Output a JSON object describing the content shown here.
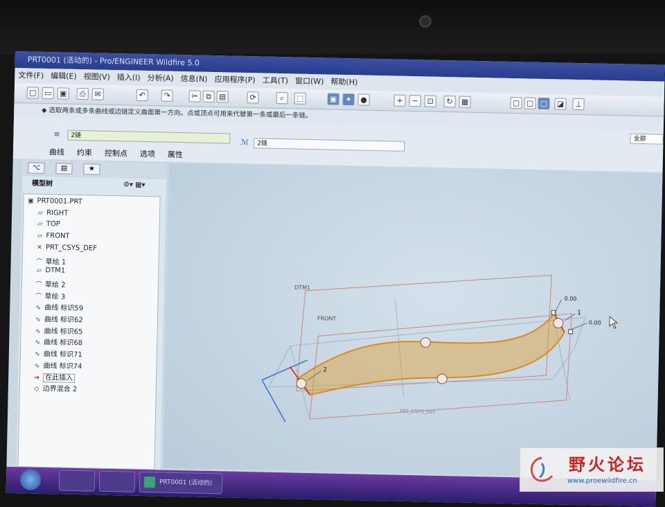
{
  "window": {
    "title": "PRT0001 (活动的) - Pro/ENGINEER Wildfire 5.0"
  },
  "menu": {
    "items": [
      "文件(F)",
      "编辑(E)",
      "视图(V)",
      "插入(I)",
      "分析(A)",
      "信息(N)",
      "应用程序(P)",
      "工具(T)",
      "窗口(W)",
      "帮助(H)"
    ]
  },
  "toolbar": {
    "icons": [
      "new-icon",
      "open-icon",
      "save-icon",
      "print-icon",
      "email-icon",
      "undo-icon",
      "redo-icon",
      "cut-icon",
      "copy-icon",
      "paste-icon",
      "regenerate-icon",
      "find-icon",
      "select-box-icon",
      "datum-display-icon",
      "spin-center-icon",
      "shading-icon",
      "zoom-in-icon",
      "zoom-out-icon",
      "refit-icon",
      "orient-icon",
      "view-manager-icon",
      "wireframe-icon",
      "hidden-line-icon",
      "shade-icon",
      "datum-plane-icon",
      "datum-axis-icon"
    ]
  },
  "prompt": {
    "text": "◆ 选取两条或多条曲线或边链定义曲面第一方向。点或顶点可用来代替第一条或最后一条链。"
  },
  "dashboard": {
    "first_direction_value": "2链",
    "second_direction_value": "2链",
    "tabs": [
      "曲线",
      "约束",
      "控制点",
      "选项",
      "属性"
    ],
    "filter_value": "全部"
  },
  "model_tree": {
    "header": "模型树",
    "items": [
      {
        "icon": "part-icon",
        "label": "PRT0001.PRT"
      },
      {
        "icon": "datum-plane-icon",
        "label": "RIGHT"
      },
      {
        "icon": "datum-plane-icon",
        "label": "TOP"
      },
      {
        "icon": "datum-plane-icon",
        "label": "FRONT"
      },
      {
        "icon": "csys-icon",
        "label": "PRT_CSYS_DEF"
      },
      {
        "icon": "sketch-icon",
        "label": "草绘 1"
      },
      {
        "icon": "datum-plane-icon",
        "label": "DTM1"
      },
      {
        "icon": "sketch-icon",
        "label": "草绘 2"
      },
      {
        "icon": "sketch-icon",
        "label": "草绘 3"
      },
      {
        "icon": "curve-icon",
        "label": "曲线 标识59"
      },
      {
        "icon": "curve-icon",
        "label": "曲线 标识62"
      },
      {
        "icon": "curve-icon",
        "label": "曲线 标识65"
      },
      {
        "icon": "curve-icon",
        "label": "曲线 标识68"
      },
      {
        "icon": "curve-icon",
        "label": "曲线 标识71"
      },
      {
        "icon": "curve-icon",
        "label": "曲线 标识74"
      },
      {
        "icon": "insert-arrow-icon",
        "label": "在此插入"
      },
      {
        "icon": "boundary-blend-icon",
        "label": "边界混合 2"
      }
    ]
  },
  "viewport": {
    "labels": {
      "dtm1": "DTM1",
      "front": "FRONT",
      "handle_2": "2",
      "handle_1": "1",
      "value_a": "0.00",
      "value_b": "0.00",
      "csys": "PRT_CSYS_DEF"
    },
    "colors": {
      "surface": "#e0a030",
      "edge": "#d98b20",
      "datum": "#c06c55",
      "axis": "#3c6fd0"
    }
  },
  "taskbar": {
    "active_window": "PRT0001 (活动的)"
  },
  "watermark": {
    "name": "野火论坛",
    "url": "www.proewildfire.cn"
  }
}
